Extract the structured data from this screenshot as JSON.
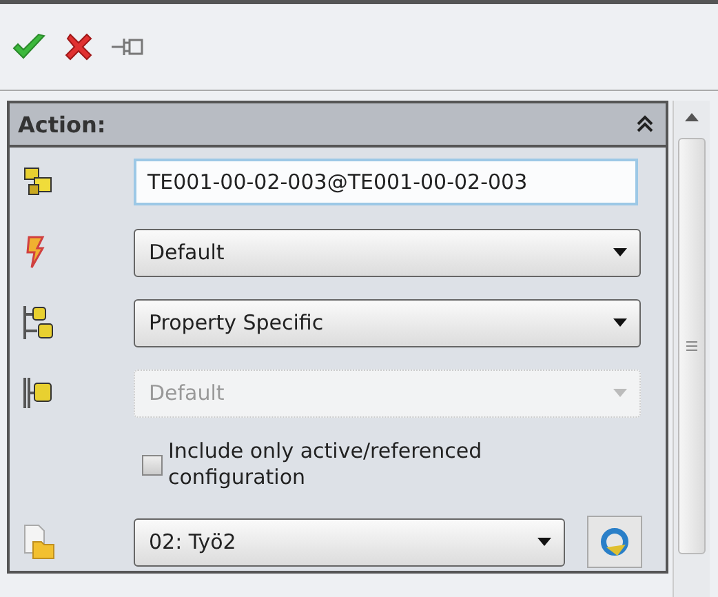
{
  "section": {
    "title": "Action:",
    "expanded": true
  },
  "rows": [
    {
      "kind": "text",
      "value": "TE001-00-02-003@TE001-00-02-003"
    },
    {
      "kind": "select",
      "value": "Default",
      "disabled": false
    },
    {
      "kind": "select",
      "value": "Property Specific",
      "disabled": false
    },
    {
      "kind": "select",
      "value": "Default",
      "disabled": true
    },
    {
      "kind": "checkbox",
      "label": "Include only active/referenced configuration",
      "checked": false
    },
    {
      "kind": "combo",
      "value": "02: Työ2",
      "disabled": false
    }
  ]
}
